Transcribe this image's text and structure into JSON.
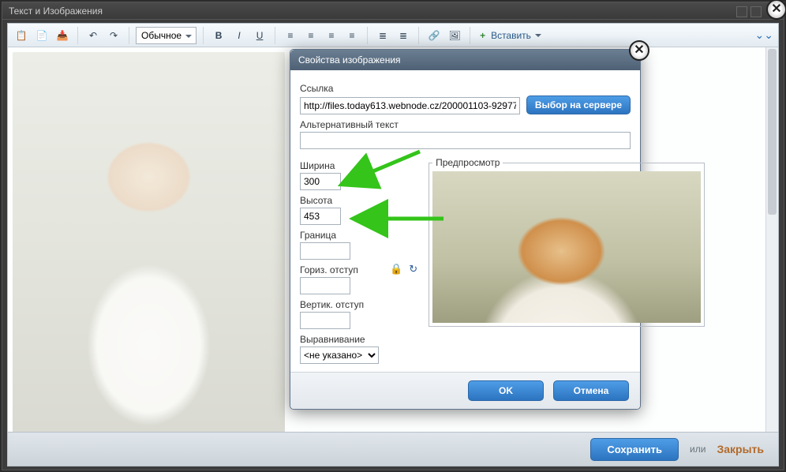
{
  "window": {
    "title": "Текст и Изображения"
  },
  "toolbar": {
    "style_label": "Обычное",
    "insert_label": "Вставить"
  },
  "footer": {
    "save": "Сохранить",
    "or": "или",
    "close": "Закрыть"
  },
  "modal": {
    "title": "Свойства изображения",
    "link_label": "Ссылка",
    "link_value": "http://files.today613.webnode.cz/200001103-92977",
    "browse_server": "Выбор на сервере",
    "alt_label": "Альтернативный текст",
    "alt_value": "",
    "width_label": "Ширина",
    "width_value": "300",
    "height_label": "Высота",
    "height_value": "453",
    "preview_legend": "Предпросмотр",
    "border_label": "Граница",
    "border_value": "",
    "hspace_label": "Гориз. отступ",
    "hspace_value": "",
    "vspace_label": "Вертик. отступ",
    "vspace_value": "",
    "align_label": "Выравнивание",
    "align_value": "<не указано>",
    "ok": "OK",
    "cancel": "Отмена"
  }
}
